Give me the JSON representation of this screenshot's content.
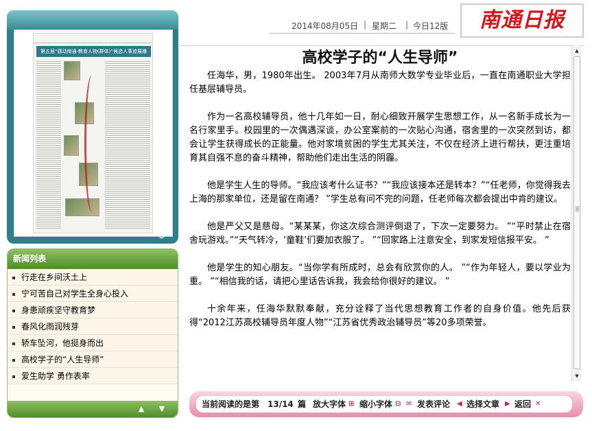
{
  "header": {
    "date": "2014年08月05日",
    "weekday": "星期二",
    "pages": "今日12版",
    "masthead": "南通日报"
  },
  "thumbnail": {
    "banner": "第五届“感动南通·教育人物(群体)”候选人事迹展播"
  },
  "news_list": {
    "title": "新闻列表",
    "items": [
      "行走在乡间沃土上",
      "宁可苦自己对学生全身心投入",
      "身患顽疾坚守教育梦",
      "春风化雨润残芽",
      "轿车坠河，他挺身而出",
      "高校学子的“人生导师”",
      "爱生助学 勇作表率"
    ]
  },
  "article": {
    "title": "高校学子的“人生导师”",
    "paragraphs": [
      "任海华，男，1980年出生。 2003年7月从南师大数学专业毕业后，一直在南通职业大学担任基层辅导员。",
      "作为一名高校辅导员，他十几年如一日，耐心细致开展学生思想工作，从一名新手成长为一名行家里手。校园里的一次偶遇深谈，办公室案前的一次贴心沟通，宿舍里的一次突然到访，都会让学生获得成长的正能量。他对家境贫困的学生尤其关注，不仅在经济上进行帮扶，更注重培育其自强不息的奋斗精神，帮助他们走出生活的阴霾。",
      "他是学生人生的导师。“我应该考什么证书？”“我应该接本还是转本？”“任老师，你觉得我去上海的那家单位，还是留在南通？ ”学生总有问不完的问题，任老师每次都会提出中肯的建议。",
      "他是严父又是慈母。“某某某，你这次综合测评倒退了，下次一定要努力。 ”“平时禁止在宿舍玩游戏。”“天气转冷，‘童鞋’们要加衣服了。 ”“回家路上注意安全，到家发短信报平安。 ”",
      "他是学生的知心朋友。“当你学有所成时，总会有欣赏你的人。 ”“作为年轻人，要以学业为重。 ”“相信我的话，请把心里话告诉我，我会给你很好的建议。 ”",
      "十余年来，任海华默默奉献，充分诠释了当代思想教育工作者的自身价值。他先后获得“2012江苏高校辅导员年度人物”“江苏省优秀政治辅导员”等20多项荣誉。"
    ]
  },
  "toolbar": {
    "reading_label": "当前阅读的是第",
    "reading_pos": "13/14",
    "reading_unit": "篇",
    "zoom_in": "放大字体",
    "zoom_out": "缩小字体",
    "comment": "发表评论",
    "select": "选择文章",
    "back": "返回"
  }
}
